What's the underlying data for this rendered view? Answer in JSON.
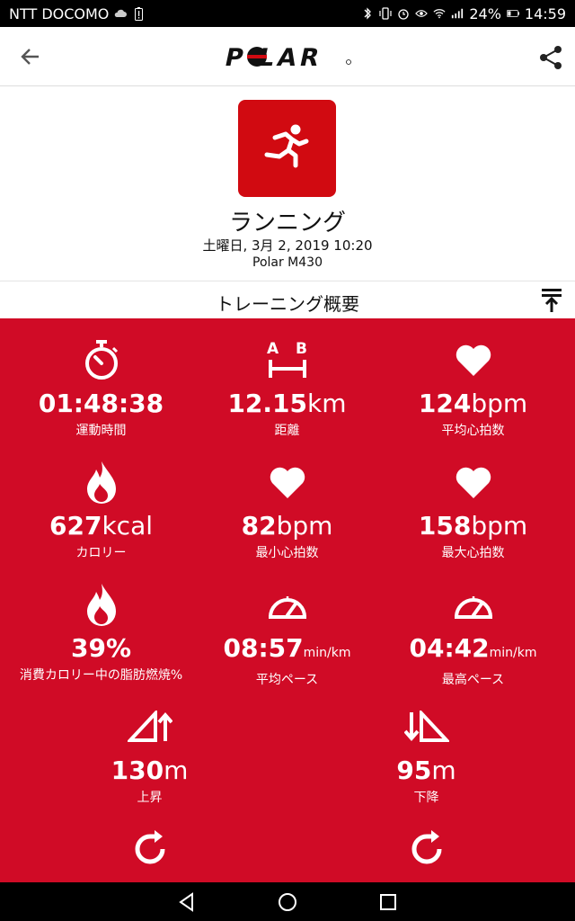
{
  "status_bar": {
    "carrier": "NTT DOCOMO",
    "battery": "24%",
    "time": "14:59"
  },
  "app_bar": {
    "logo_text": "POLAR"
  },
  "summary": {
    "sport": "ランニング",
    "date": "土曜日, 3月 2, 2019 10:20",
    "device": "Polar M430"
  },
  "section": {
    "title": "トレーニング概要"
  },
  "stats": [
    {
      "value": "01:48:38",
      "unit": "",
      "label": "運動時間",
      "icon": "stopwatch-icon"
    },
    {
      "value": "12.15",
      "unit": "km",
      "label": "距離",
      "icon": "distance-ab-icon"
    },
    {
      "value": "124",
      "unit": "bpm",
      "label": "平均心拍数",
      "icon": "heart-icon"
    },
    {
      "value": "627",
      "unit": "kcal",
      "label": "カロリー",
      "icon": "flame-icon"
    },
    {
      "value": "82",
      "unit": "bpm",
      "label": "最小心拍数",
      "icon": "heart-icon"
    },
    {
      "value": "158",
      "unit": "bpm",
      "label": "最大心拍数",
      "icon": "heart-icon"
    },
    {
      "value": "39%",
      "unit": "",
      "label": "消費カロリー中の脂肪燃焼%",
      "icon": "flame-icon"
    },
    {
      "value": "08:57",
      "unit": "min/km",
      "label": "平均ペース",
      "icon": "speedometer-icon"
    },
    {
      "value": "04:42",
      "unit": "min/km",
      "label": "最高ペース",
      "icon": "speedometer-icon"
    },
    {
      "value": "130",
      "unit": "m",
      "label": "上昇",
      "icon": "ascent-icon"
    },
    {
      "value": "95",
      "unit": "m",
      "label": "下降",
      "icon": "descent-icon"
    },
    {
      "value": "",
      "unit": "",
      "label": "",
      "icon": "cadence-icon"
    },
    {
      "value": "",
      "unit": "",
      "label": "",
      "icon": "cadence-icon"
    }
  ],
  "colors": {
    "accent_red": "#d00b26",
    "tile_red": "#d10a11"
  }
}
